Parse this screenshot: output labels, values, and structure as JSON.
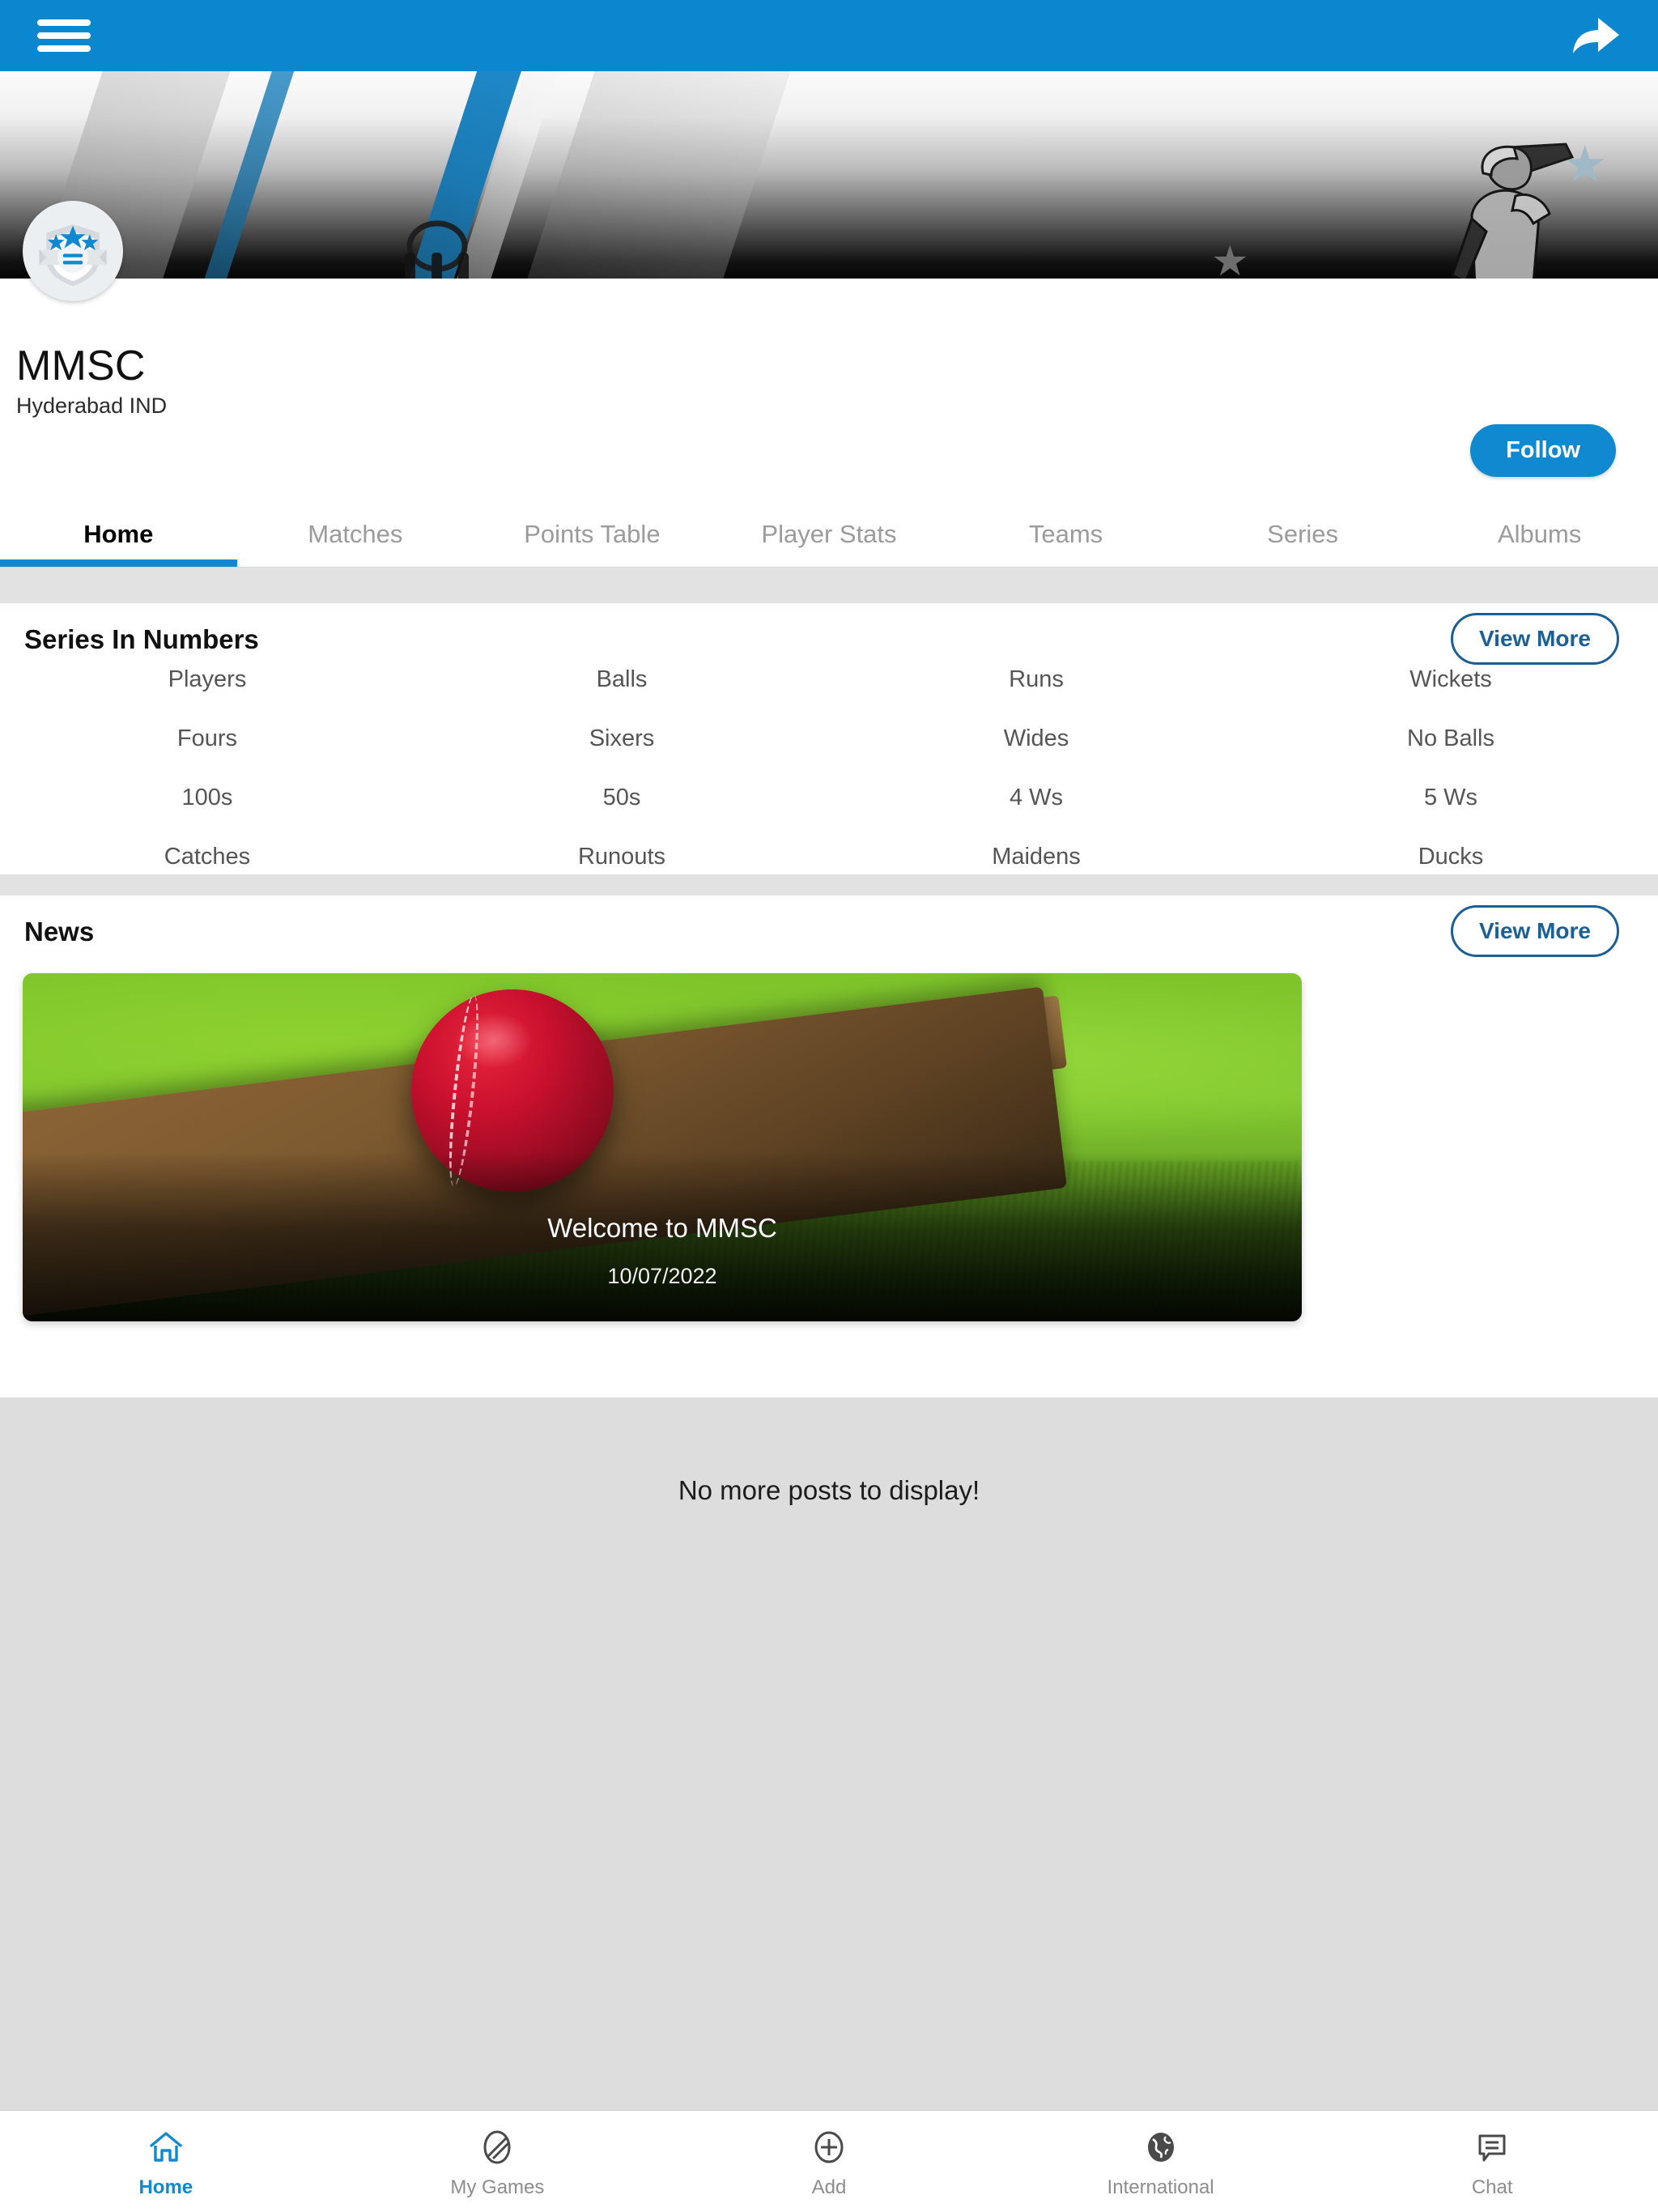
{
  "appbar": {
    "menu_icon": "hamburger-menu-icon",
    "share_icon": "share-icon"
  },
  "profile": {
    "badge_icon": "shield-stars-badge-icon",
    "team_name": "MMSC",
    "location": "Hyderabad IND",
    "follow_label": "Follow"
  },
  "tabs": [
    {
      "label": "Home",
      "active": true
    },
    {
      "label": "Matches",
      "active": false
    },
    {
      "label": "Points Table",
      "active": false
    },
    {
      "label": "Player Stats",
      "active": false
    },
    {
      "label": "Teams",
      "active": false
    },
    {
      "label": "Series",
      "active": false
    },
    {
      "label": "Albums",
      "active": false
    }
  ],
  "series_in_numbers": {
    "title": "Series In Numbers",
    "view_more_label": "View More",
    "stats": [
      {
        "label": "Players",
        "value": ""
      },
      {
        "label": "Balls",
        "value": ""
      },
      {
        "label": "Runs",
        "value": ""
      },
      {
        "label": "Wickets",
        "value": ""
      },
      {
        "label": "Fours",
        "value": ""
      },
      {
        "label": "Sixers",
        "value": ""
      },
      {
        "label": "Wides",
        "value": ""
      },
      {
        "label": "No Balls",
        "value": ""
      },
      {
        "label": "100s",
        "value": ""
      },
      {
        "label": "50s",
        "value": ""
      },
      {
        "label": "4 Ws",
        "value": ""
      },
      {
        "label": "5 Ws",
        "value": ""
      },
      {
        "label": "Catches",
        "value": ""
      },
      {
        "label": "Runouts",
        "value": ""
      },
      {
        "label": "Maidens",
        "value": ""
      },
      {
        "label": "Ducks",
        "value": ""
      }
    ]
  },
  "news": {
    "title": "News",
    "view_more_label": "View More",
    "item": {
      "title": "Welcome to MMSC",
      "date": "10/07/2022"
    }
  },
  "feed": {
    "empty_message": "No more posts to display!"
  },
  "bottom_nav": [
    {
      "label": "Home",
      "icon": "home-icon",
      "active": true
    },
    {
      "label": "My Games",
      "icon": "cricket-ball-icon",
      "active": false
    },
    {
      "label": "Add",
      "icon": "plus-circle-icon",
      "active": false
    },
    {
      "label": "International",
      "icon": "globe-icon",
      "active": false
    },
    {
      "label": "Chat",
      "icon": "chat-bubble-icon",
      "active": false
    }
  ],
  "colors": {
    "primary": "#0b87cf",
    "accent": "#1089d1",
    "outline_blue": "#1a5f96",
    "page_bg": "#dddddd"
  }
}
